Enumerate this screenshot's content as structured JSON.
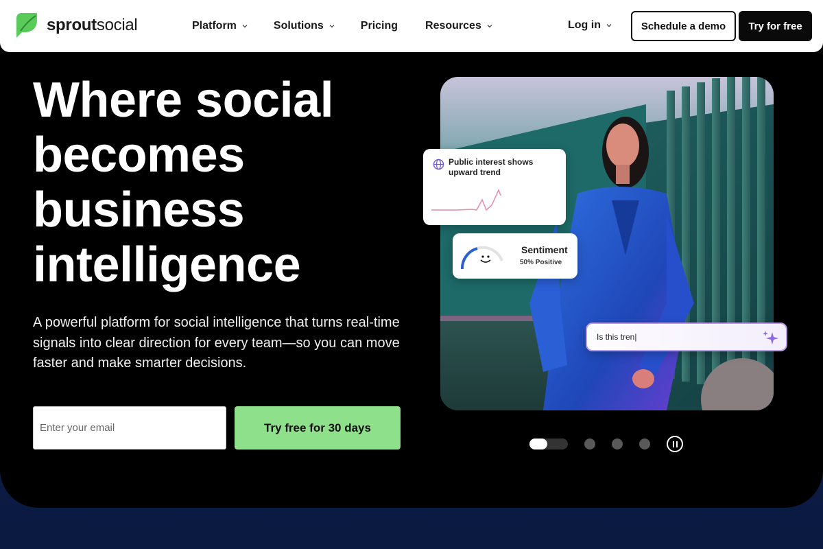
{
  "brand": {
    "name_bold": "sprout",
    "name_light": "social",
    "accent": "#59cb59"
  },
  "nav": {
    "items": [
      {
        "label": "Platform",
        "has_dropdown": true
      },
      {
        "label": "Solutions",
        "has_dropdown": true
      },
      {
        "label": "Pricing",
        "has_dropdown": false
      },
      {
        "label": "Resources",
        "has_dropdown": true
      }
    ],
    "login": "Log in",
    "demo_button": "Schedule a demo",
    "try_button": "Try for free"
  },
  "hero": {
    "headline_lines": [
      "Where social",
      "becomes",
      "business",
      "intelligence"
    ],
    "subtext": "A powerful platform for social intelligence that turns real-time signals into clear direction for every team—so you can move faster and make smarter decisions.",
    "email_placeholder": "Enter your email",
    "trial_button": "Try free for 30 days",
    "trial_color": "#8ee08a"
  },
  "cards": {
    "trend": {
      "title": "Public interest shows upward trend",
      "icon": "globe-icon"
    },
    "sentiment": {
      "title": "Sentiment",
      "value": "50% Positive",
      "icon": "smile-icon"
    },
    "ask": {
      "text": "Is this tren|",
      "icon": "sparkle-icon"
    }
  },
  "carousel": {
    "slides": 4,
    "active": 1
  }
}
